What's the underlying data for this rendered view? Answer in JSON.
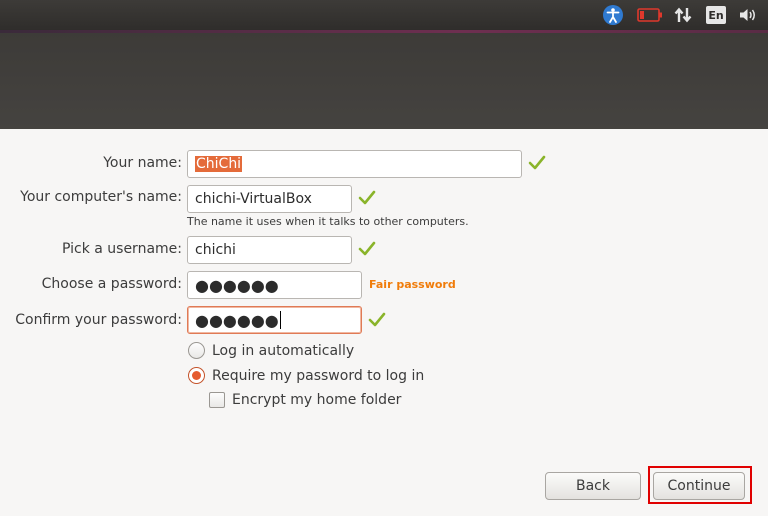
{
  "topbar": {
    "icons": [
      "accessibility-icon",
      "battery-icon",
      "network-icon",
      "keyboard-layout-indicator",
      "volume-icon"
    ],
    "keyboard_layout": "En",
    "colors": {
      "panel": "#3c3b37",
      "accent": "#e95420",
      "battery": "#df382c"
    }
  },
  "form": {
    "your_name": {
      "label": "Your name:",
      "value": "ChiChi",
      "valid": true
    },
    "computer_name": {
      "label": "Your computer's name:",
      "value": "chichi-VirtualBox",
      "hint": "The name it uses when it talks to other computers.",
      "valid": true
    },
    "username": {
      "label": "Pick a username:",
      "value": "chichi",
      "valid": true
    },
    "password": {
      "label": "Choose a password:",
      "value": "●●●●●●",
      "strength": "Fair password"
    },
    "confirm_password": {
      "label": "Confirm your password:",
      "value": "●●●●●●",
      "valid": true
    },
    "login_options": {
      "auto_login": {
        "label": "Log in automatically",
        "selected": false
      },
      "require_password": {
        "label": "Require my password to log in",
        "selected": true
      },
      "encrypt_home": {
        "label": "Encrypt my home folder",
        "checked": false
      }
    }
  },
  "buttons": {
    "back": "Back",
    "continue": "Continue"
  }
}
